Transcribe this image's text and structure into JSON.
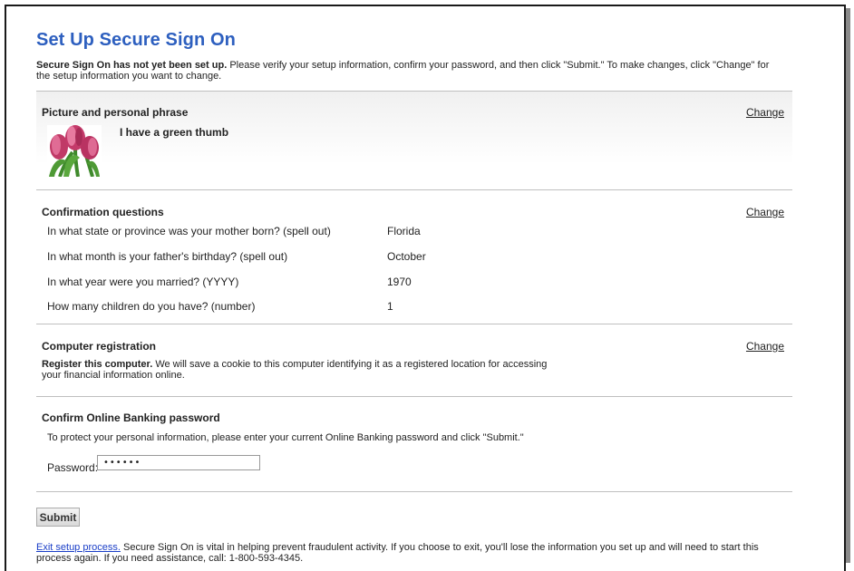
{
  "page": {
    "title": "Set Up Secure Sign On",
    "intro_bold": "Secure Sign On has not yet been set up.",
    "intro_rest": " Please verify your setup information, confirm your password, and then click \"Submit.\" To make changes, click \"Change\" for the setup information you want to change."
  },
  "picture_section": {
    "heading": "Picture and personal phrase",
    "change_label": "Change",
    "image_icon": "tulip-image",
    "phrase": "I have a green thumb"
  },
  "questions_section": {
    "heading": "Confirmation questions",
    "change_label": "Change",
    "rows": [
      {
        "question": "In what state or province was your mother born? (spell out)",
        "answer": "Florida"
      },
      {
        "question": "In what month is your father's birthday? (spell out)",
        "answer": "October"
      },
      {
        "question": "In what year were you married? (YYYY)",
        "answer": "1970"
      },
      {
        "question": "How many children do you have? (number)",
        "answer": "1"
      }
    ]
  },
  "registration_section": {
    "heading": "Computer registration",
    "change_label": "Change",
    "text_bold": "Register this computer.",
    "text_rest": " We will save a cookie to this computer identifying it as a registered location for accessing your financial information online."
  },
  "password_section": {
    "heading": "Confirm Online Banking password",
    "instructions": "To protect your personal information, please enter your current Online Banking password and click \"Submit.\"",
    "label": "Password:",
    "value": "••••••"
  },
  "actions": {
    "submit_label": "Submit"
  },
  "footer": {
    "exit_link": "Exit setup process.",
    "text": " Secure Sign On is vital in helping prevent fraudulent activity. If you choose to exit, you'll lose the information you set up and will need to start this process again. If you need assistance, call: 1-800-593-4345."
  },
  "colors": {
    "title": "#2d5fbf",
    "link": "#1a3ec7",
    "divider": "#bfbfbf"
  }
}
